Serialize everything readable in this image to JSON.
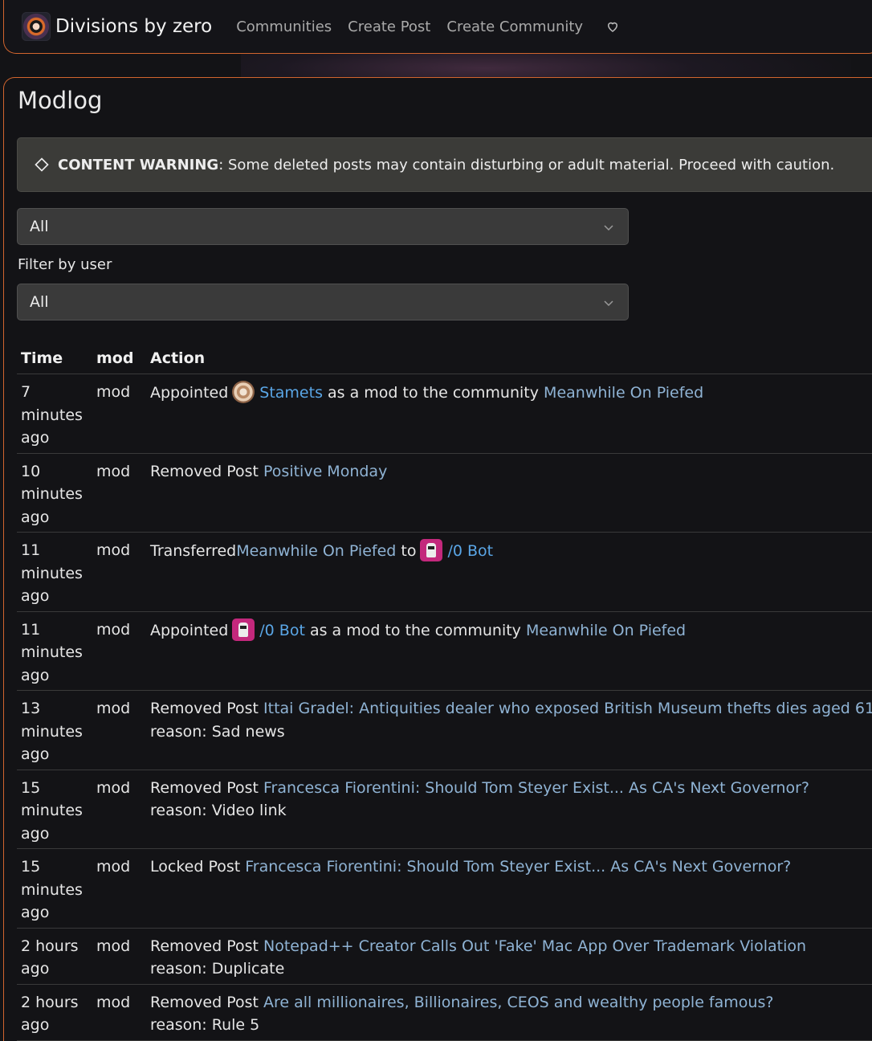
{
  "header": {
    "brand": "Divisions by zero",
    "nav": [
      "Communities",
      "Create Post",
      "Create Community"
    ]
  },
  "page": {
    "title": "Modlog",
    "warning_label": "CONTENT WARNING",
    "warning_text": ": Some deleted posts may contain disturbing or adult material. Proceed with caution.",
    "action_filter": "All",
    "user_filter_label": "Filter by user",
    "user_filter": "All"
  },
  "table": {
    "headers": [
      "Time",
      "mod",
      "Action"
    ],
    "rows": [
      {
        "time": "7 minutes ago",
        "mod": "mod",
        "pre": "Appointed",
        "avatar": "stamets",
        "user": "Stamets",
        "mid": "as a mod to the community",
        "link": "Meanwhile On Piefed",
        "reason": ""
      },
      {
        "time": "10 minutes ago",
        "mod": "mod",
        "pre": "Removed Post",
        "link": "Positive Monday",
        "reason": ""
      },
      {
        "time": "11 minutes ago",
        "mod": "mod",
        "pre": "Transferred",
        "link": "Meanwhile On Piefed",
        "post": "to",
        "avatar": "bot",
        "user": "/0 Bot",
        "reason": ""
      },
      {
        "time": "11 minutes ago",
        "mod": "mod",
        "pre": "Appointed",
        "avatar": "bot",
        "user": "/0 Bot",
        "mid": "as a mod to the community",
        "link": "Meanwhile On Piefed",
        "reason": ""
      },
      {
        "time": "13 minutes ago",
        "mod": "mod",
        "pre": "Removed Post",
        "link": "Ittai Gradel: Antiquities dealer who exposed British Museum thefts dies aged 61",
        "reason": "reason: Sad news"
      },
      {
        "time": "15 minutes ago",
        "mod": "mod",
        "pre": "Removed Post",
        "link": "Francesca Fiorentini: Should Tom Steyer Exist... As CA's Next Governor?",
        "reason": "reason: Video link"
      },
      {
        "time": "15 minutes ago",
        "mod": "mod",
        "pre": "Locked Post",
        "link": "Francesca Fiorentini: Should Tom Steyer Exist... As CA's Next Governor?",
        "reason": ""
      },
      {
        "time": "2 hours ago",
        "mod": "mod",
        "pre": "Removed Post",
        "link": "Notepad++ Creator Calls Out 'Fake' Mac App Over Trademark Violation",
        "reason": "reason: Duplicate"
      },
      {
        "time": "2 hours ago",
        "mod": "mod",
        "pre": "Removed Post",
        "link": "Are all millionaires, Billionaires, CEOS and wealthy people famous?",
        "reason": "reason: Rule 5"
      }
    ]
  },
  "colors": {
    "accent_border": "#d2652e",
    "link": "#8fb3d4",
    "user_link": "#5aa6e6"
  }
}
